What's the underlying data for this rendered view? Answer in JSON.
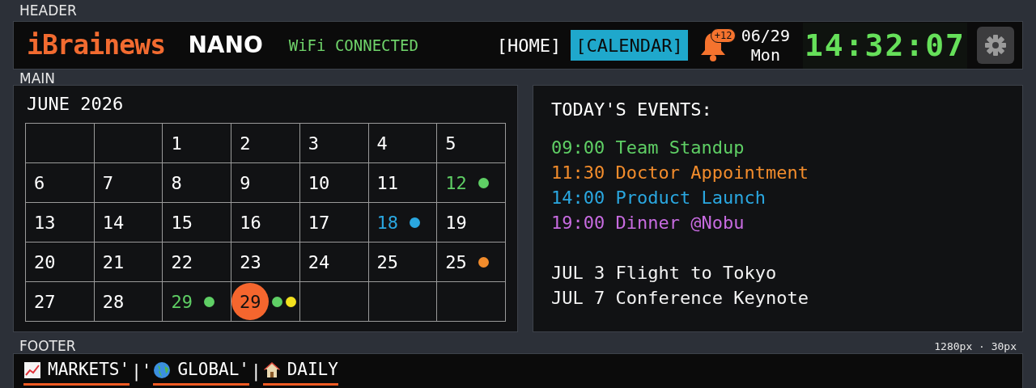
{
  "header": {
    "section_label": "HEADER",
    "brand": "iBrainews",
    "model": "NANO",
    "wifi": "WiFi CONNECTED",
    "nav": [
      {
        "label": "[HOME]",
        "selected": false
      },
      {
        "label": "[CALENDAR]",
        "selected": true
      }
    ],
    "notification_badge": "+12",
    "date": "06/29",
    "weekday": "Mon",
    "clock": "14:32:07"
  },
  "main": {
    "section_label": "MAIN",
    "calendar": {
      "title": "JUNE 2026",
      "rows": [
        [
          {},
          {},
          {
            "day": "1"
          },
          {
            "day": "2"
          },
          {
            "day": "3"
          },
          {
            "day": "4"
          },
          {
            "day": "5"
          }
        ],
        [
          {
            "day": "6"
          },
          {
            "day": "7"
          },
          {
            "day": "8"
          },
          {
            "day": "9"
          },
          {
            "day": "10"
          },
          {
            "day": "11"
          },
          {
            "day": "12",
            "tinted": true,
            "dots": [
              {
                "color": "#5fcf65"
              }
            ]
          }
        ],
        [
          {
            "day": "13"
          },
          {
            "day": "14"
          },
          {
            "day": "15"
          },
          {
            "day": "16"
          },
          {
            "day": "17"
          },
          {
            "day": "18",
            "tinted": true,
            "dots": [
              {
                "color": "#2aa7e0"
              }
            ]
          },
          {
            "day": "19"
          }
        ],
        [
          {
            "day": "20"
          },
          {
            "day": "21"
          },
          {
            "day": "22"
          },
          {
            "day": "23"
          },
          {
            "day": "24"
          },
          {
            "day": "25"
          },
          {
            "day": "25",
            "tinted": false,
            "dots": [
              {
                "color": "#f28c2c"
              }
            ]
          }
        ],
        [
          {
            "day": "27"
          },
          {
            "day": "28"
          },
          {
            "day": "29",
            "tinted": true,
            "dots": [
              {
                "color": "#5fcf65"
              }
            ]
          },
          {
            "day": "29",
            "today": true,
            "dots": [
              {
                "color": "#5fcf65"
              },
              {
                "color": "#f2e01e"
              }
            ]
          },
          {},
          {},
          {}
        ]
      ]
    },
    "events": {
      "title": "TODAY'S EVENTS:",
      "today": [
        {
          "time": "09:00",
          "title": "Team Standup",
          "color": "#5fcf65"
        },
        {
          "time": "11:30",
          "title": "Doctor Appointment",
          "color": "#f28c2c"
        },
        {
          "time": "14:00",
          "title": "Product Launch",
          "color": "#2aa7e0"
        },
        {
          "time": "19:00",
          "title": "Dinner @Nobu",
          "color": "#c76be0"
        }
      ],
      "upcoming": [
        {
          "date": "JUL 3",
          "title": "Flight to Tokyo"
        },
        {
          "date": "JUL 7",
          "title": "Conference Keynote"
        }
      ]
    }
  },
  "footer": {
    "section_label": "FOOTER",
    "size_note": "1280px · 30px",
    "tabs": [
      {
        "kind": "chart",
        "label": "MARKETS'"
      },
      {
        "kind": "globe",
        "label": "GLOBAL'"
      },
      {
        "kind": "house",
        "label": "DAILY"
      }
    ],
    "separators": [
      "|'",
      "|"
    ]
  }
}
